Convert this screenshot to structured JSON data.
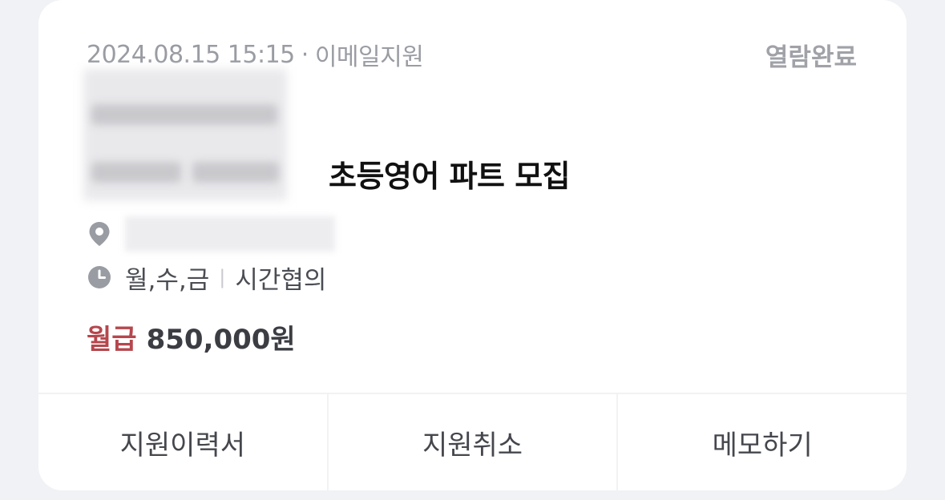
{
  "card": {
    "date": "2024.08.15 15:15",
    "separator": "·",
    "apply_method": "이메일지원",
    "status": "열람완료",
    "title": "초등영어 파트 모집",
    "days": "월,수,금",
    "info_separator": "|",
    "hours": "시간협의",
    "salary_type": "월급",
    "salary_amount": "850,000원"
  },
  "icons": {
    "location": "map-pin-icon",
    "time": "clock-icon"
  },
  "actions": [
    {
      "label": "지원이력서"
    },
    {
      "label": "지원취소"
    },
    {
      "label": "메모하기"
    }
  ],
  "colors": {
    "salary_type": "#b5474d",
    "status": "#a0a2a8",
    "background": "#f1f2f5"
  }
}
